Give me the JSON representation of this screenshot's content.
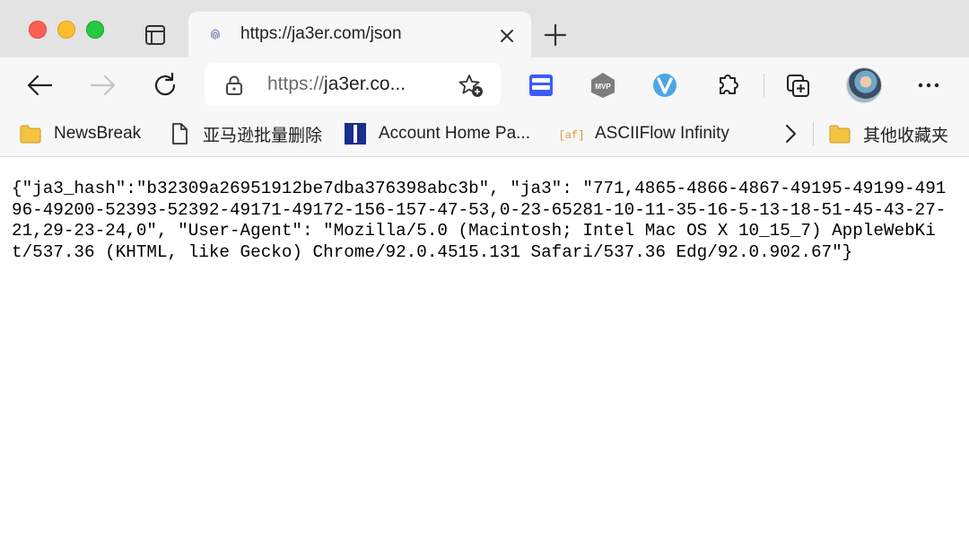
{
  "tabs": [
    {
      "title": "https://ja3er.com/json",
      "active": true
    }
  ],
  "address_bar": {
    "scheme": "https://",
    "display_url": "ja3er.co..."
  },
  "bookmarks": [
    {
      "label": "NewsBreak",
      "icon": "folder-icon"
    },
    {
      "label": "亚马逊批量删除",
      "icon": "page-icon"
    },
    {
      "label": "Account Home Pa...",
      "icon": "bookmark-favicon"
    },
    {
      "label": "ASCIIFlow Infinity",
      "icon": "asciiflow-favicon"
    }
  ],
  "other_bookmarks": {
    "label": "其他收藏夹",
    "icon": "folder-icon"
  },
  "page": {
    "json_text": "{\"ja3_hash\":\"b32309a26951912be7dba376398abc3b\", \"ja3\": \"771,4865-4866-4867-49195-49199-49196-49200-52393-52392-49171-49172-156-157-47-53,0-23-65281-10-11-35-16-5-13-18-51-45-43-27-21,29-23-24,0\", \"User-Agent\": \"Mozilla/5.0 (Macintosh; Intel Mac OS X 10_15_7) AppleWebKit/537.36 (KHTML, like Gecko) Chrome/92.0.4515.131 Safari/537.36 Edg/92.0.902.67\"}"
  },
  "colors": {
    "tab_strip": "#e3e3e3",
    "toolbar": "#f7f7f7",
    "close_red": "#fe5f57",
    "minimize_yellow": "#febc2e",
    "zoom_green": "#28c840",
    "folder": "#f5c342"
  }
}
